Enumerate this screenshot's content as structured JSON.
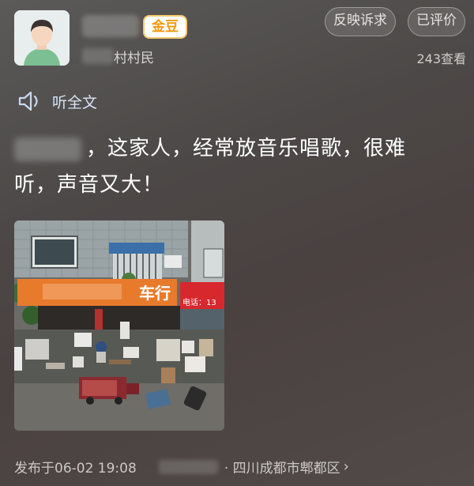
{
  "header": {
    "badge": "金豆",
    "village_suffix": "村村民",
    "report_button": "反映诉求",
    "rated_button": "已评价",
    "views": "243查看"
  },
  "listen_label": "听全文",
  "post": {
    "text_line1": "，这家人，经常放音乐唱歌，很难",
    "text_line2": "听，声音又大！"
  },
  "photo": {
    "shop_sign": "车行",
    "red_sign": "电话：13"
  },
  "footer": {
    "published": "发布于06-02 19:08",
    "location": "· 四川成都市郫都区",
    "chevron": "›"
  }
}
